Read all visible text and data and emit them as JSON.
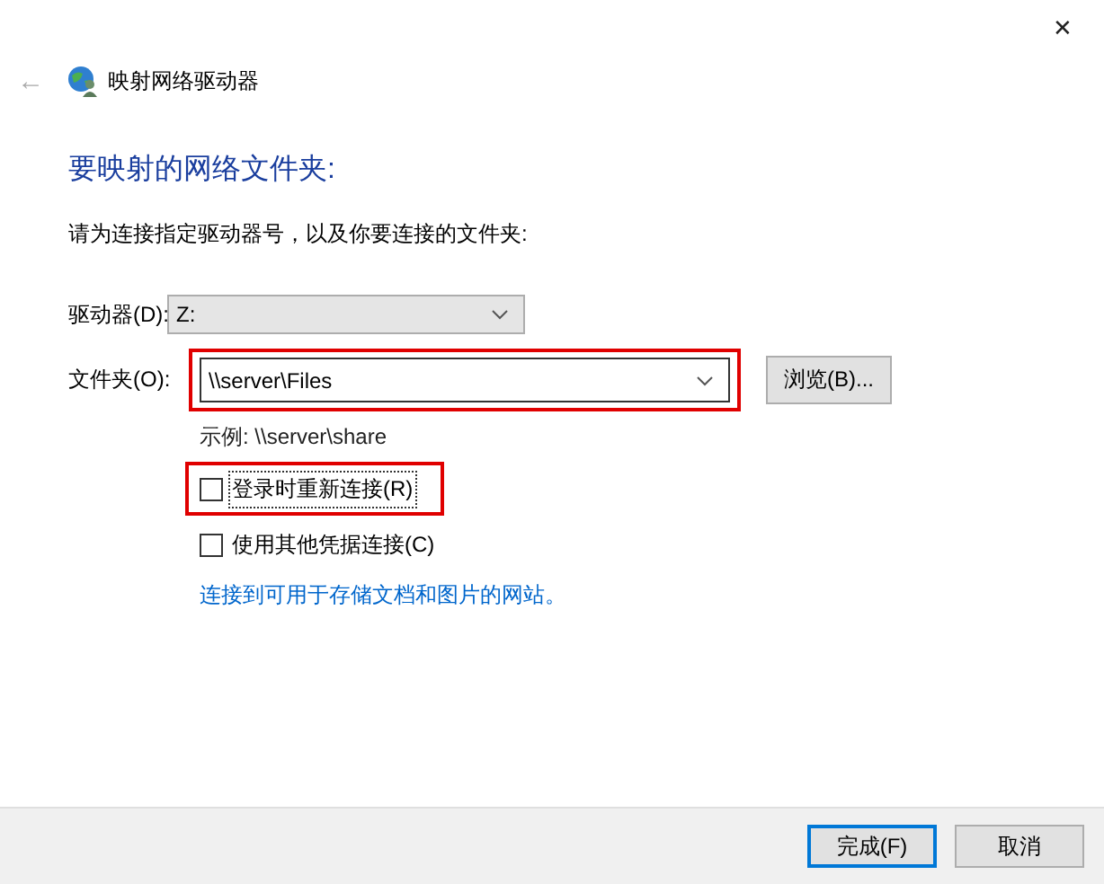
{
  "window": {
    "close": "✕",
    "back": "←",
    "title": "映射网络驱动器"
  },
  "heading": "要映射的网络文件夹:",
  "instruction": "请为连接指定驱动器号，以及你要连接的文件夹:",
  "drive": {
    "label": "驱动器(D):",
    "value": "Z:",
    "disabled": true
  },
  "folder": {
    "label": "文件夹(O):",
    "value": "\\\\server\\Files",
    "highlighted": true,
    "browse": "浏览(B)..."
  },
  "example": "示例: \\\\server\\share",
  "options": [
    {
      "label": "登录时重新连接(R)",
      "checked": false,
      "highlighted": true,
      "focused": true
    },
    {
      "label": "使用其他凭据连接(C)",
      "checked": false,
      "highlighted": false,
      "focused": false
    }
  ],
  "link": "连接到可用于存储文档和图片的网站。",
  "buttons": [
    {
      "label": "完成(F)",
      "default": true
    },
    {
      "label": "取消",
      "default": false
    }
  ]
}
